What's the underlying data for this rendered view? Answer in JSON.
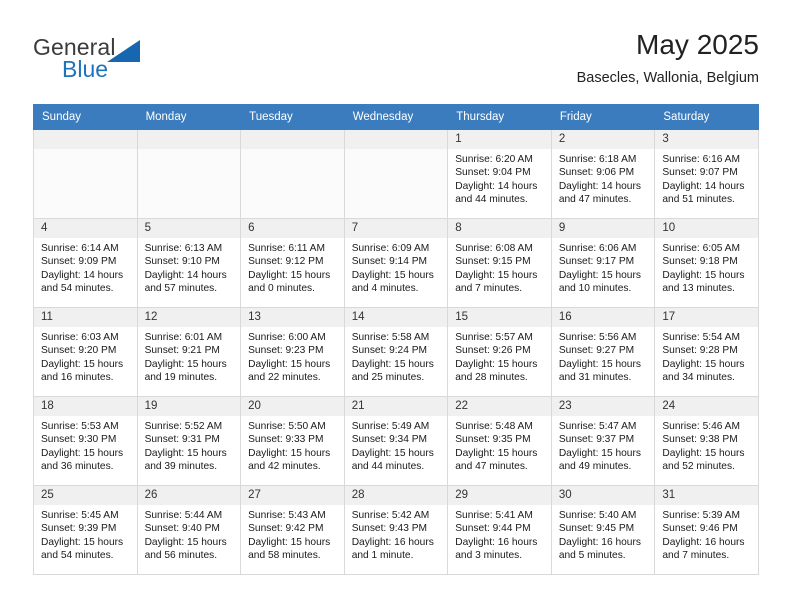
{
  "brand": {
    "name_top": "General",
    "name_bottom": "Blue",
    "accent_color": "#1666b0"
  },
  "header": {
    "title": "May 2025",
    "location": "Basecles, Wallonia, Belgium"
  },
  "calendar": {
    "header_bg": "#3a7cbe",
    "weekdays": [
      "Sunday",
      "Monday",
      "Tuesday",
      "Wednesday",
      "Thursday",
      "Friday",
      "Saturday"
    ],
    "weeks": [
      [
        {
          "day": "",
          "lines": []
        },
        {
          "day": "",
          "lines": []
        },
        {
          "day": "",
          "lines": []
        },
        {
          "day": "",
          "lines": []
        },
        {
          "day": "1",
          "lines": [
            "Sunrise: 6:20 AM",
            "Sunset: 9:04 PM",
            "Daylight: 14 hours",
            "and 44 minutes."
          ]
        },
        {
          "day": "2",
          "lines": [
            "Sunrise: 6:18 AM",
            "Sunset: 9:06 PM",
            "Daylight: 14 hours",
            "and 47 minutes."
          ]
        },
        {
          "day": "3",
          "lines": [
            "Sunrise: 6:16 AM",
            "Sunset: 9:07 PM",
            "Daylight: 14 hours",
            "and 51 minutes."
          ]
        }
      ],
      [
        {
          "day": "4",
          "lines": [
            "Sunrise: 6:14 AM",
            "Sunset: 9:09 PM",
            "Daylight: 14 hours",
            "and 54 minutes."
          ]
        },
        {
          "day": "5",
          "lines": [
            "Sunrise: 6:13 AM",
            "Sunset: 9:10 PM",
            "Daylight: 14 hours",
            "and 57 minutes."
          ]
        },
        {
          "day": "6",
          "lines": [
            "Sunrise: 6:11 AM",
            "Sunset: 9:12 PM",
            "Daylight: 15 hours",
            "and 0 minutes."
          ]
        },
        {
          "day": "7",
          "lines": [
            "Sunrise: 6:09 AM",
            "Sunset: 9:14 PM",
            "Daylight: 15 hours",
            "and 4 minutes."
          ]
        },
        {
          "day": "8",
          "lines": [
            "Sunrise: 6:08 AM",
            "Sunset: 9:15 PM",
            "Daylight: 15 hours",
            "and 7 minutes."
          ]
        },
        {
          "day": "9",
          "lines": [
            "Sunrise: 6:06 AM",
            "Sunset: 9:17 PM",
            "Daylight: 15 hours",
            "and 10 minutes."
          ]
        },
        {
          "day": "10",
          "lines": [
            "Sunrise: 6:05 AM",
            "Sunset: 9:18 PM",
            "Daylight: 15 hours",
            "and 13 minutes."
          ]
        }
      ],
      [
        {
          "day": "11",
          "lines": [
            "Sunrise: 6:03 AM",
            "Sunset: 9:20 PM",
            "Daylight: 15 hours",
            "and 16 minutes."
          ]
        },
        {
          "day": "12",
          "lines": [
            "Sunrise: 6:01 AM",
            "Sunset: 9:21 PM",
            "Daylight: 15 hours",
            "and 19 minutes."
          ]
        },
        {
          "day": "13",
          "lines": [
            "Sunrise: 6:00 AM",
            "Sunset: 9:23 PM",
            "Daylight: 15 hours",
            "and 22 minutes."
          ]
        },
        {
          "day": "14",
          "lines": [
            "Sunrise: 5:58 AM",
            "Sunset: 9:24 PM",
            "Daylight: 15 hours",
            "and 25 minutes."
          ]
        },
        {
          "day": "15",
          "lines": [
            "Sunrise: 5:57 AM",
            "Sunset: 9:26 PM",
            "Daylight: 15 hours",
            "and 28 minutes."
          ]
        },
        {
          "day": "16",
          "lines": [
            "Sunrise: 5:56 AM",
            "Sunset: 9:27 PM",
            "Daylight: 15 hours",
            "and 31 minutes."
          ]
        },
        {
          "day": "17",
          "lines": [
            "Sunrise: 5:54 AM",
            "Sunset: 9:28 PM",
            "Daylight: 15 hours",
            "and 34 minutes."
          ]
        }
      ],
      [
        {
          "day": "18",
          "lines": [
            "Sunrise: 5:53 AM",
            "Sunset: 9:30 PM",
            "Daylight: 15 hours",
            "and 36 minutes."
          ]
        },
        {
          "day": "19",
          "lines": [
            "Sunrise: 5:52 AM",
            "Sunset: 9:31 PM",
            "Daylight: 15 hours",
            "and 39 minutes."
          ]
        },
        {
          "day": "20",
          "lines": [
            "Sunrise: 5:50 AM",
            "Sunset: 9:33 PM",
            "Daylight: 15 hours",
            "and 42 minutes."
          ]
        },
        {
          "day": "21",
          "lines": [
            "Sunrise: 5:49 AM",
            "Sunset: 9:34 PM",
            "Daylight: 15 hours",
            "and 44 minutes."
          ]
        },
        {
          "day": "22",
          "lines": [
            "Sunrise: 5:48 AM",
            "Sunset: 9:35 PM",
            "Daylight: 15 hours",
            "and 47 minutes."
          ]
        },
        {
          "day": "23",
          "lines": [
            "Sunrise: 5:47 AM",
            "Sunset: 9:37 PM",
            "Daylight: 15 hours",
            "and 49 minutes."
          ]
        },
        {
          "day": "24",
          "lines": [
            "Sunrise: 5:46 AM",
            "Sunset: 9:38 PM",
            "Daylight: 15 hours",
            "and 52 minutes."
          ]
        }
      ],
      [
        {
          "day": "25",
          "lines": [
            "Sunrise: 5:45 AM",
            "Sunset: 9:39 PM",
            "Daylight: 15 hours",
            "and 54 minutes."
          ]
        },
        {
          "day": "26",
          "lines": [
            "Sunrise: 5:44 AM",
            "Sunset: 9:40 PM",
            "Daylight: 15 hours",
            "and 56 minutes."
          ]
        },
        {
          "day": "27",
          "lines": [
            "Sunrise: 5:43 AM",
            "Sunset: 9:42 PM",
            "Daylight: 15 hours",
            "and 58 minutes."
          ]
        },
        {
          "day": "28",
          "lines": [
            "Sunrise: 5:42 AM",
            "Sunset: 9:43 PM",
            "Daylight: 16 hours",
            "and 1 minute."
          ]
        },
        {
          "day": "29",
          "lines": [
            "Sunrise: 5:41 AM",
            "Sunset: 9:44 PM",
            "Daylight: 16 hours",
            "and 3 minutes."
          ]
        },
        {
          "day": "30",
          "lines": [
            "Sunrise: 5:40 AM",
            "Sunset: 9:45 PM",
            "Daylight: 16 hours",
            "and 5 minutes."
          ]
        },
        {
          "day": "31",
          "lines": [
            "Sunrise: 5:39 AM",
            "Sunset: 9:46 PM",
            "Daylight: 16 hours",
            "and 7 minutes."
          ]
        }
      ]
    ]
  }
}
